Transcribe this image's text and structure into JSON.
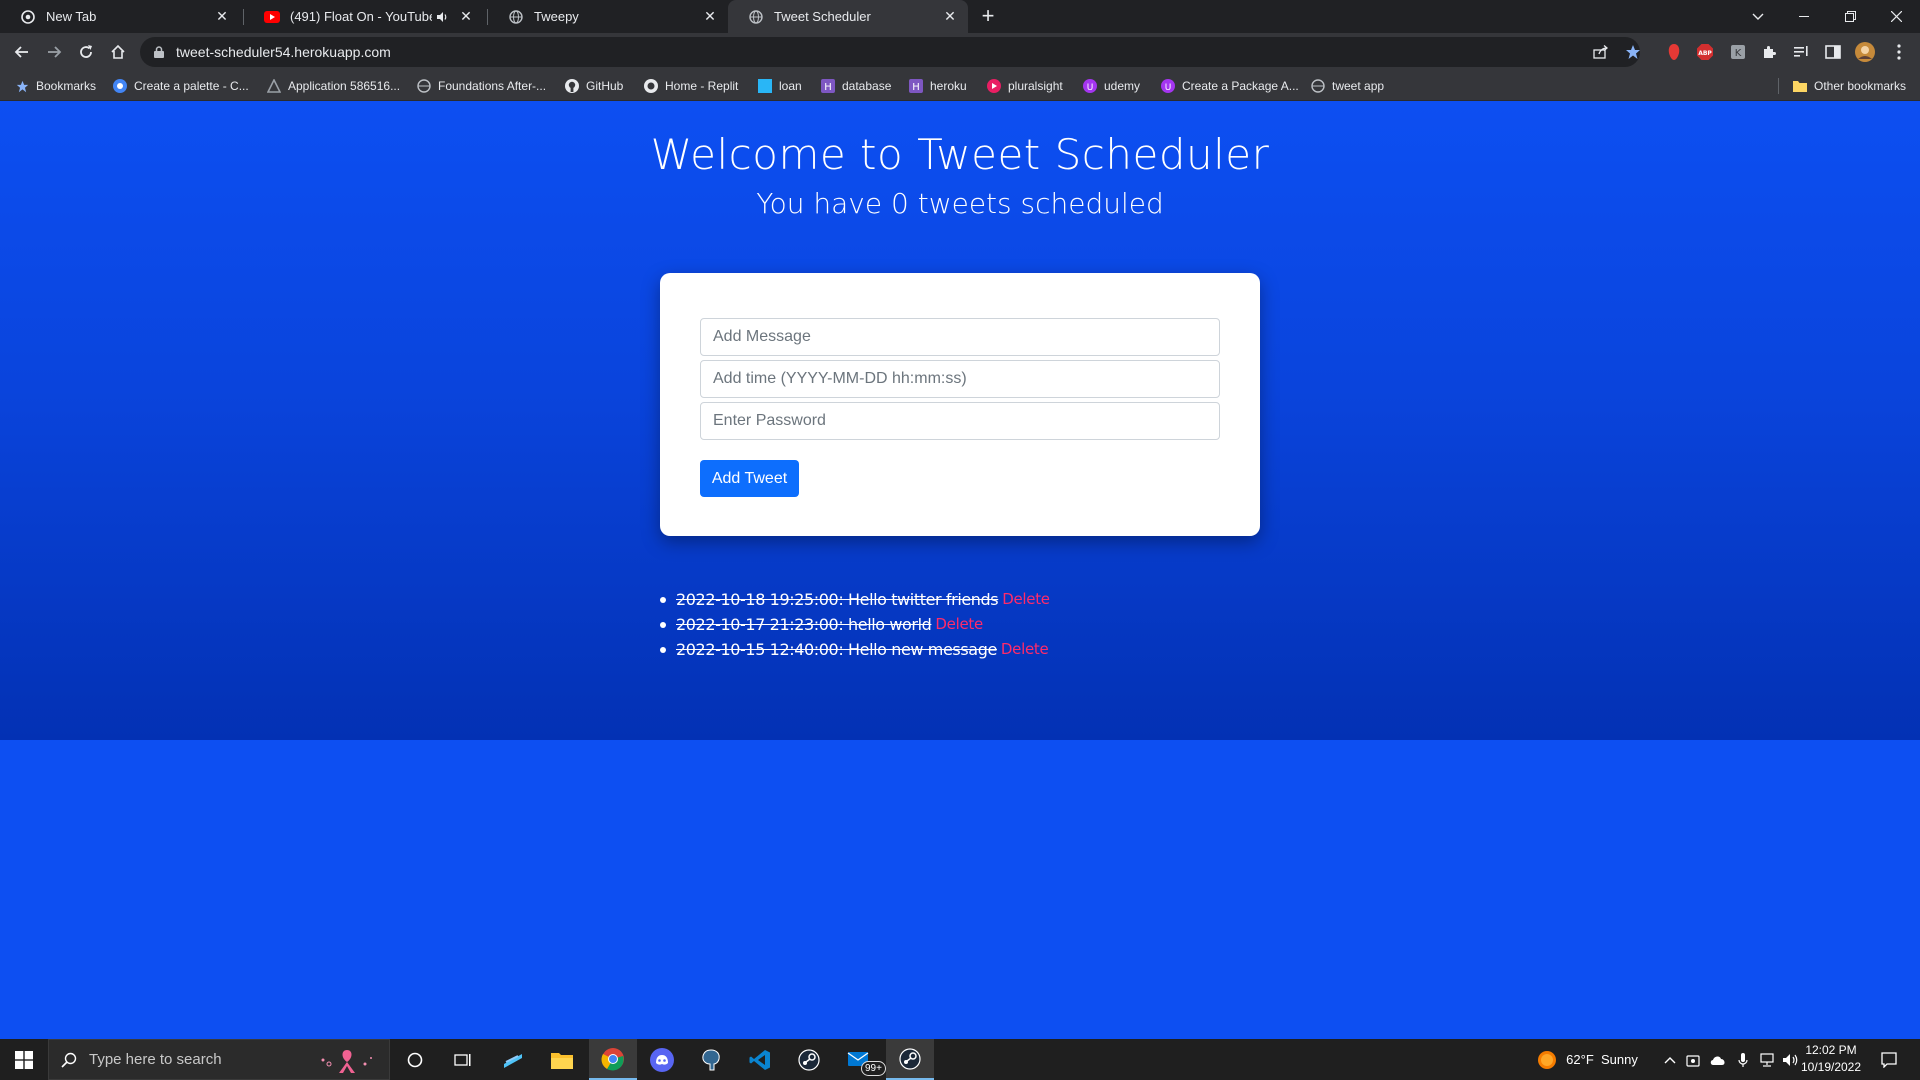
{
  "browser": {
    "tabs": [
      {
        "title": "New Tab",
        "icon": "chrome-icon"
      },
      {
        "title": "(491) Float On - YouTube",
        "icon": "youtube-icon",
        "muted_icon": "speaker-icon"
      },
      {
        "title": "Tweepy",
        "icon": "globe-icon"
      },
      {
        "title": "Tweet Scheduler",
        "icon": "globe-icon",
        "active": true
      }
    ],
    "new_tab_label": "+",
    "url": "tweet-scheduler54.herokuapp.com",
    "bookmarks": [
      {
        "label": "Bookmarks",
        "icon": "star-icon"
      },
      {
        "label": "Create a palette - C...",
        "icon": "palette-icon"
      },
      {
        "label": "Application 586516...",
        "icon": "app-icon"
      },
      {
        "label": "Foundations After-...",
        "icon": "globe-icon"
      },
      {
        "label": "GitHub",
        "icon": "github-icon"
      },
      {
        "label": "Home - Replit",
        "icon": "replit-icon"
      },
      {
        "label": "loan",
        "icon": "square-icon"
      },
      {
        "label": "database",
        "icon": "heroku-icon"
      },
      {
        "label": "heroku",
        "icon": "heroku-icon"
      },
      {
        "label": "pluralsight",
        "icon": "pluralsight-icon"
      },
      {
        "label": "udemy",
        "icon": "udemy-icon"
      },
      {
        "label": "Create a Package A...",
        "icon": "udemy-icon"
      },
      {
        "label": "tweet app",
        "icon": "globe-icon"
      }
    ],
    "other_bookmarks": "Other bookmarks"
  },
  "page": {
    "title": "Welcome to Tweet Scheduler",
    "subtitle": "You have 0 tweets scheduled",
    "form": {
      "message_placeholder": "Add Message",
      "time_placeholder": "Add time (YYYY-MM-DD hh:mm:ss)",
      "password_placeholder": "Enter Password",
      "submit_label": "Add Tweet"
    },
    "tweets": [
      {
        "text": "2022-10-18 19:25:00: Hello twitter friends",
        "delete": "Delete"
      },
      {
        "text": "2022-10-17 21:23:00: hello world",
        "delete": "Delete"
      },
      {
        "text": "2022-10-15 12:40:00: Hello new message",
        "delete": "Delete"
      }
    ],
    "colors": {
      "background": "#0d4ff2",
      "button": "#0d6efd",
      "delete": "#ff2b6a"
    }
  },
  "taskbar": {
    "search_placeholder": "Type here to search",
    "weather": "62°F  Sunny",
    "time": "12:02 PM",
    "date": "10/19/2022",
    "mail_badge": "99+"
  }
}
